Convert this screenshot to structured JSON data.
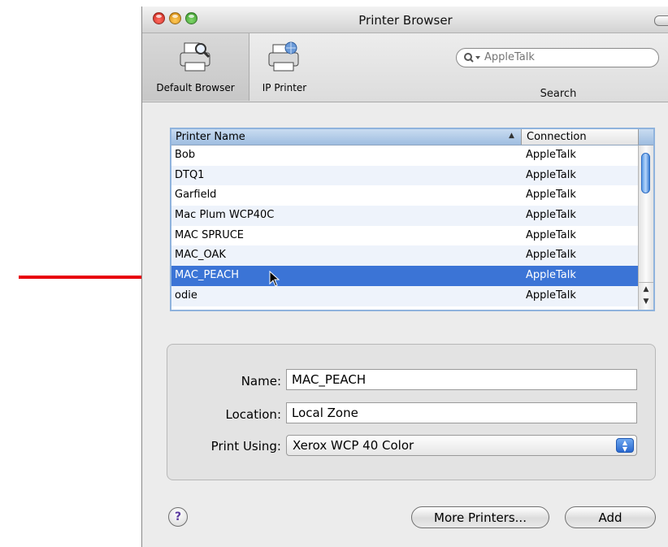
{
  "window": {
    "title": "Printer Browser"
  },
  "toolbar": {
    "default_browser_label": "Default Browser",
    "ip_printer_label": "IP Printer",
    "search_label": "Search",
    "search_placeholder": "AppleTalk"
  },
  "table": {
    "col_name": "Printer Name",
    "col_connection": "Connection",
    "rows": [
      {
        "name": "Bob",
        "connection": "AppleTalk"
      },
      {
        "name": "DTQ1",
        "connection": "AppleTalk"
      },
      {
        "name": "Garfield",
        "connection": "AppleTalk"
      },
      {
        "name": "Mac Plum WCP40C",
        "connection": "AppleTalk"
      },
      {
        "name": "MAC SPRUCE",
        "connection": "AppleTalk"
      },
      {
        "name": "MAC_OAK",
        "connection": "AppleTalk"
      },
      {
        "name": "MAC_PEACH",
        "connection": "AppleTalk"
      },
      {
        "name": "odie",
        "connection": "AppleTalk"
      }
    ],
    "selected_index": 6
  },
  "details": {
    "name_label": "Name:",
    "name_value": "MAC_PEACH",
    "location_label": "Location:",
    "location_value": "Local Zone",
    "print_using_label": "Print Using:",
    "print_using_value": "Xerox WCP 40 Color"
  },
  "buttons": {
    "help": "?",
    "more_printers": "More Printers...",
    "add": "Add"
  },
  "colors": {
    "annotation_arrow": "#e8000b",
    "selection": "#3b74d6"
  }
}
